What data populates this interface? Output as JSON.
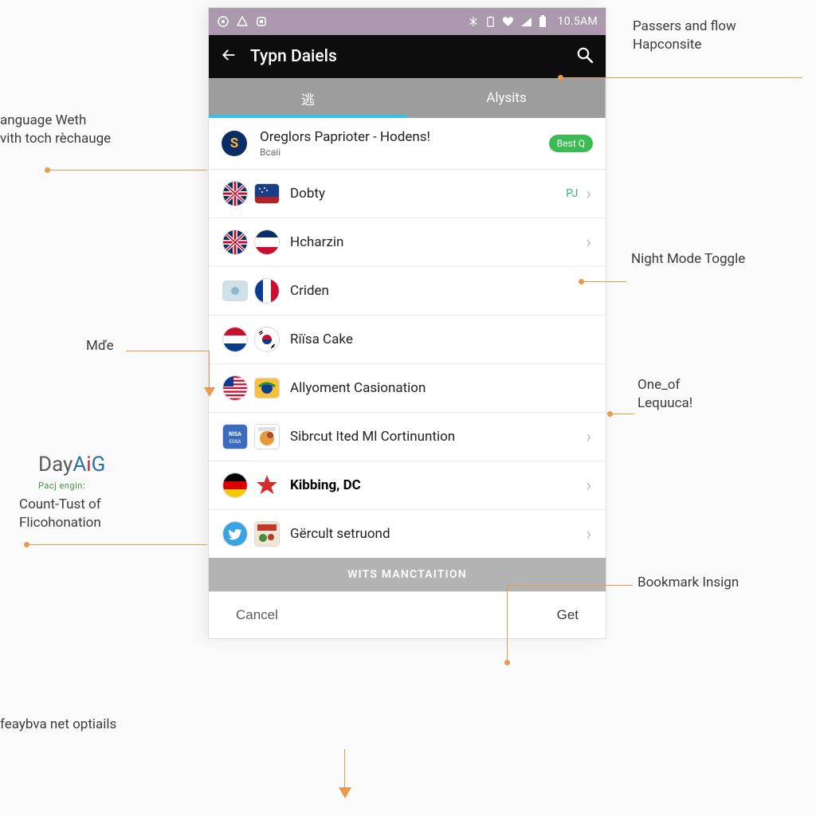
{
  "statusbar": {
    "clock": "10.5AM"
  },
  "appbar": {
    "title": "Typn Daiels"
  },
  "tabs": {
    "tab1_icon": "逃",
    "tab2_label": "Alysits"
  },
  "featured": {
    "avatar": "S",
    "title": "Oreglors Paprioter - Hodens!",
    "subtitle": "Bcaii",
    "pill": "Best Q"
  },
  "rows": [
    {
      "label": "Dobty",
      "tail": "PJ",
      "bold": false
    },
    {
      "label": "Hcharzin",
      "tail": "",
      "bold": false
    },
    {
      "label": "Criden",
      "tail": "",
      "bold": false
    },
    {
      "label": "Riïsa Cake",
      "tail": "",
      "bold": false
    },
    {
      "label": "Allyoment Casionation",
      "tail": "",
      "bold": false
    },
    {
      "label": "Sibrcut Ited Ml Cortinuntion",
      "tail": "",
      "bold": false
    },
    {
      "label": "Kibbing, DC",
      "tail": "",
      "bold": true
    },
    {
      "label": "Gërcult setruond",
      "tail": "",
      "bold": false
    }
  ],
  "sectionbar": "WITS MANCTAITION",
  "actions": {
    "cancel": "Cancel",
    "get": "Get"
  },
  "callouts": {
    "top_right1": "Passers and flow",
    "top_right2": "Hapconsite",
    "left_lang1": "anguage Weth",
    "left_lang2": "vith toch rèchauge",
    "night_mode": "Night Mode Toggle",
    "mde": "Mďe",
    "one_of1": "One_of",
    "one_of2": "Lequuca!",
    "dayaig_logo": "DayAiG",
    "dayaig_sub": "Pacj engin:",
    "count1": "Count-Tust of",
    "count2": "Flicohonation",
    "bookmark": "Bookmark Insign",
    "bottom_left": "feaybva net optiails"
  }
}
